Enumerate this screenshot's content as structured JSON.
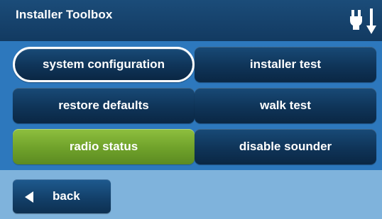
{
  "header": {
    "title": "Installer Toolbox",
    "power_icon": "ac-power-plug-icon"
  },
  "menu": {
    "buttons": [
      {
        "label": "system configuration",
        "selected": true
      },
      {
        "label": "installer test"
      },
      {
        "label": "restore defaults"
      },
      {
        "label": "walk test"
      },
      {
        "label": "radio status",
        "highlight_color": "#7fb136"
      },
      {
        "label": "disable sounder"
      }
    ]
  },
  "footer": {
    "back_label": "back",
    "back_icon": "left-arrow-icon"
  },
  "colors": {
    "header_bg": "#163f68",
    "panel_bg": "#2d78bd",
    "footer_bg": "#7fb3dc",
    "button_bg": "#0f3458",
    "highlight_bg": "#7fb136"
  }
}
